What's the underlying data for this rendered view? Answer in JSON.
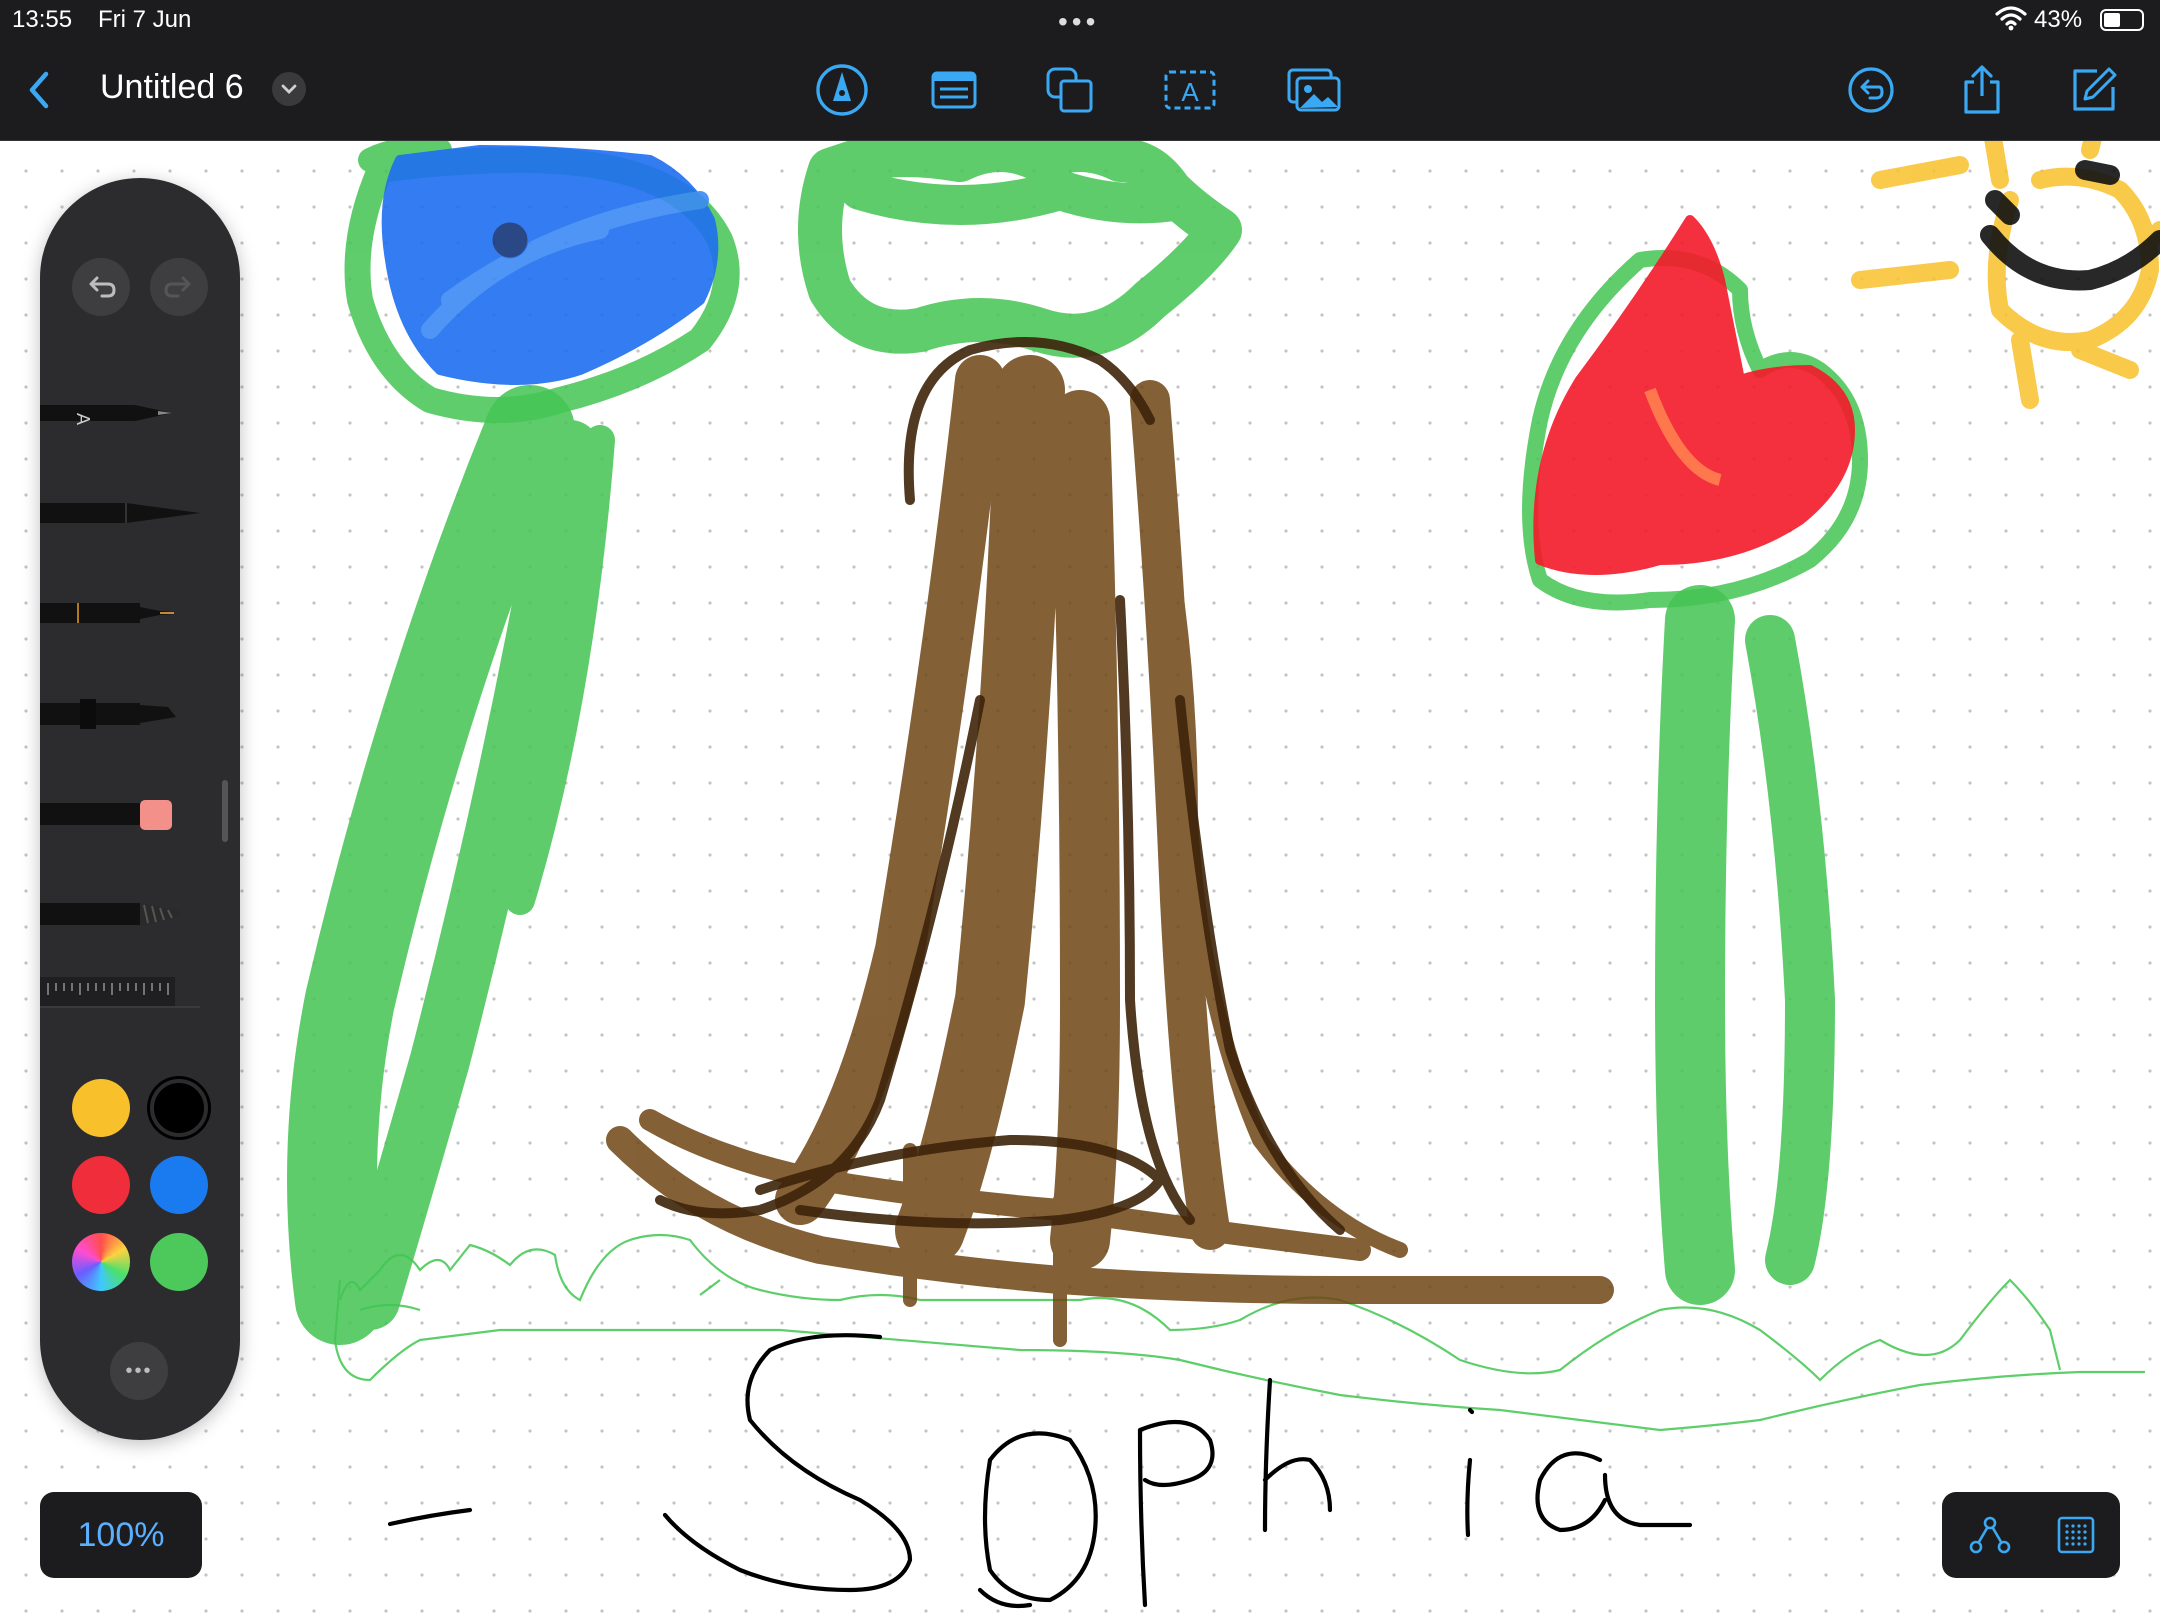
{
  "status_bar": {
    "time": "13:55",
    "date": "Fri 7 Jun",
    "multitask_dots": "•••",
    "battery_percent": "43%",
    "battery_level": 0.43
  },
  "toolbar": {
    "title": "Untitled 6",
    "icons": {
      "back": "chevron-left-icon",
      "title_menu": "chevron-down-icon",
      "pen_tool": "pen-tip-icon",
      "text_box": "text-box-icon",
      "shapes": "shapes-icon",
      "text_insert": "text-insert-icon",
      "media": "photo-icon",
      "undo_history": "undo-history-icon",
      "share": "share-icon",
      "compose": "compose-icon"
    },
    "accent_color": "#3aa8f2"
  },
  "tool_palette": {
    "tools": [
      "pen-a",
      "fineliner",
      "monoline",
      "marker",
      "eraser",
      "crayon",
      "ruler"
    ],
    "colors": [
      "#f8c12b",
      "#000000",
      "#f02d3a",
      "#1a7bf0",
      "multicolor",
      "#4cc95a"
    ],
    "selected_color": "#000000",
    "more": "•••"
  },
  "zoom": {
    "label": "100%"
  },
  "canvas": {
    "signature_text": "- Sophia",
    "background": "dot-grid"
  }
}
